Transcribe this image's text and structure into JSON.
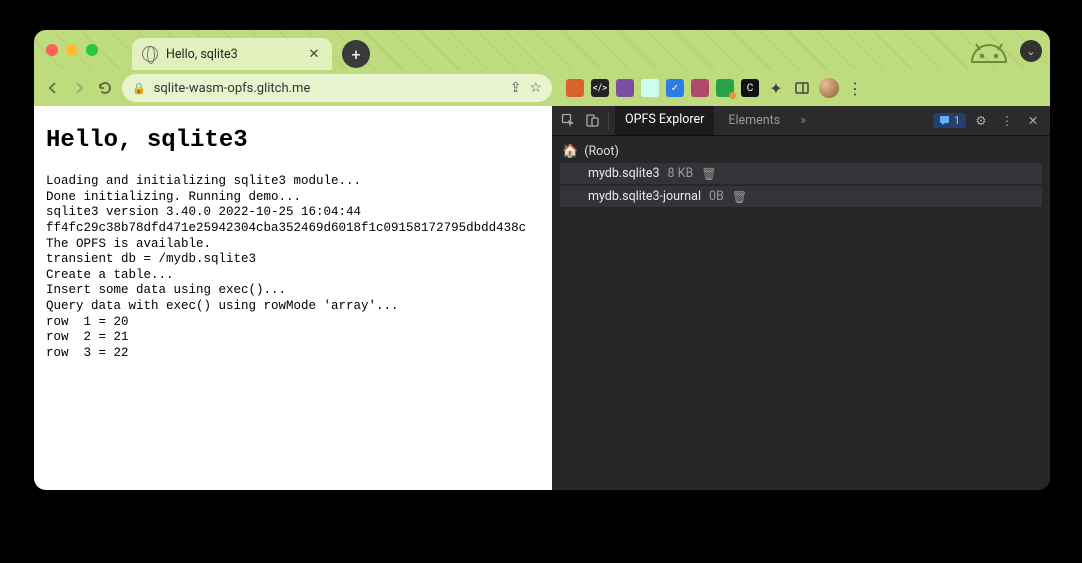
{
  "browser": {
    "tab_title": "Hello, sqlite3",
    "url": "sqlite-wasm-opfs.glitch.me",
    "new_tab_glyph": "+",
    "expand_glyph": "⌄"
  },
  "page": {
    "heading": "Hello, sqlite3",
    "lines": [
      "Loading and initializing sqlite3 module...",
      "Done initializing. Running demo...",
      "sqlite3 version 3.40.0 2022-10-25 16:04:44",
      "ff4fc29c38b78dfd471e25942304cba352469d6018f1c09158172795dbdd438c",
      "The OPFS is available.",
      "transient db = /mydb.sqlite3",
      "Create a table...",
      "Insert some data using exec()...",
      "Query data with exec() using rowMode 'array'...",
      "row  1 = 20",
      "row  2 = 21",
      "row  3 = 22"
    ]
  },
  "devtools": {
    "tabs": {
      "active": "OPFS Explorer",
      "other": "Elements",
      "more_glyph": "»"
    },
    "issues_count": "1",
    "tree": {
      "root_label": "(Root)",
      "files": [
        {
          "name": "mydb.sqlite3",
          "size": "8 KB"
        },
        {
          "name": "mydb.sqlite3-journal",
          "size": "0B"
        }
      ]
    }
  },
  "extensions": [
    {
      "bg": "#d9632b",
      "label": ""
    },
    {
      "bg": "#222",
      "label": "</>"
    },
    {
      "bg": "#7a4ea0",
      "label": ""
    },
    {
      "bg": "#cfe",
      "label": ""
    },
    {
      "bg": "#2a7de1",
      "label": "✓"
    },
    {
      "bg": "#b04a6a",
      "label": ""
    },
    {
      "bg": "#2aa24a",
      "label": "",
      "badge": true
    },
    {
      "bg": "#111",
      "label": "C"
    }
  ]
}
